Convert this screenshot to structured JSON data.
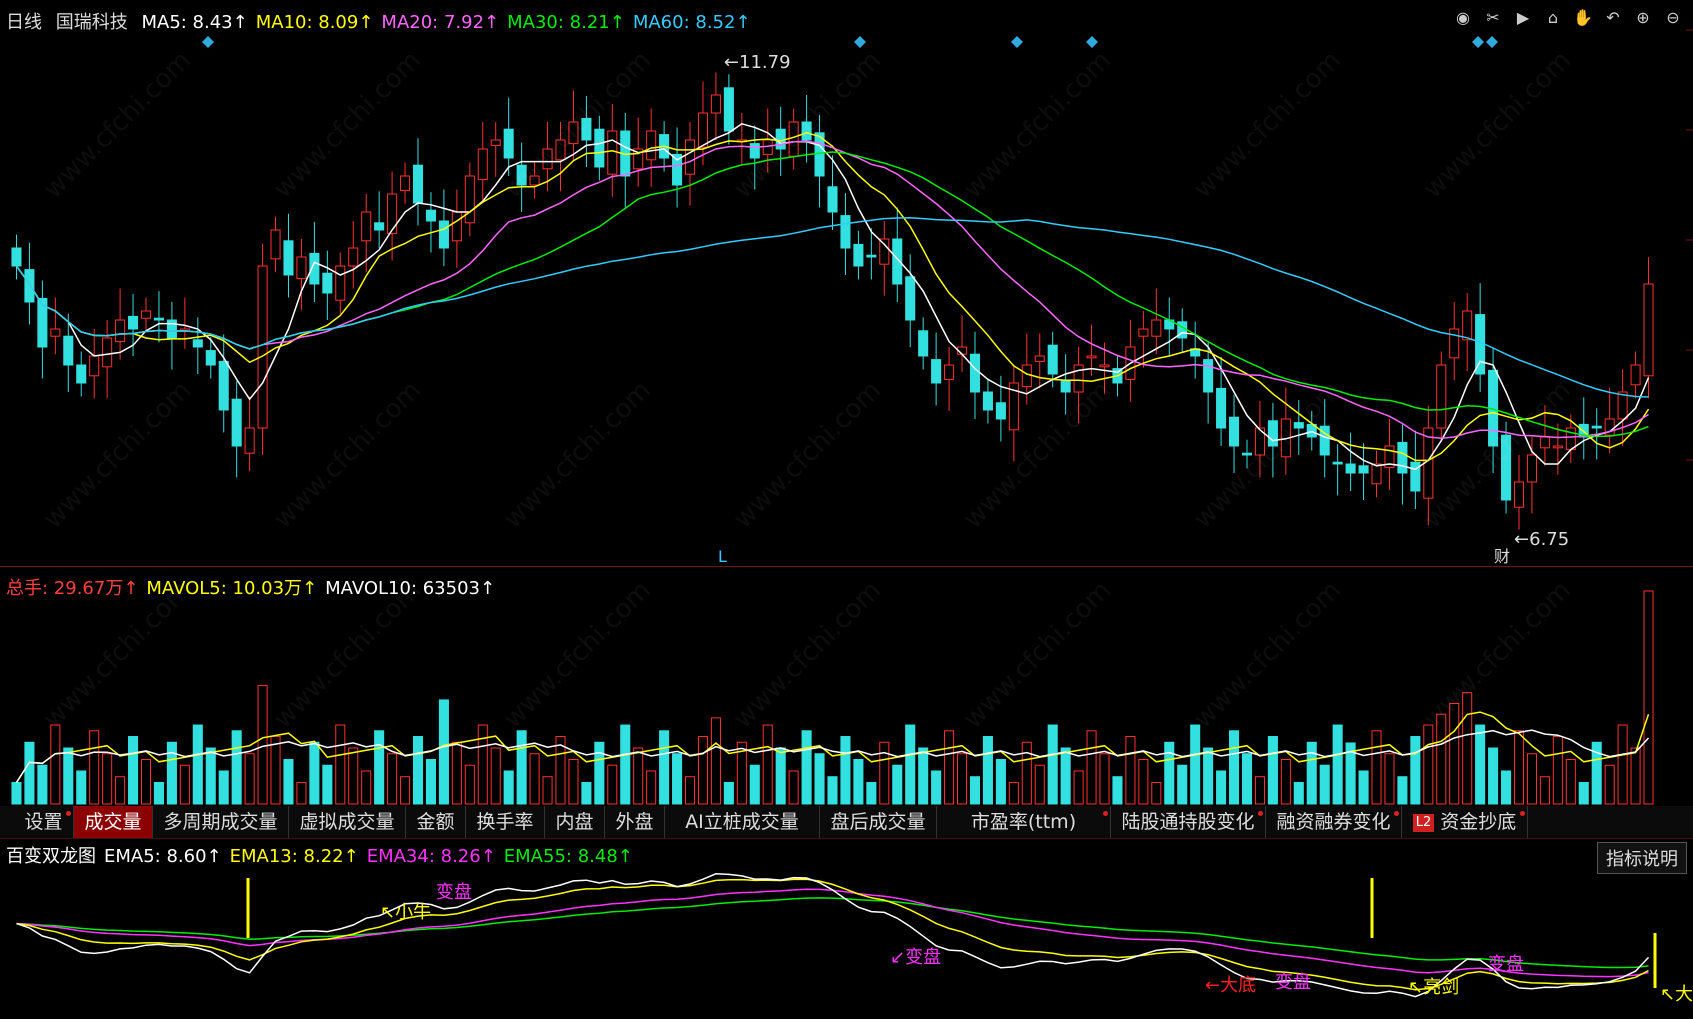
{
  "header": {
    "period": "日线",
    "stock_name": "国瑞科技",
    "ma_labels": [
      {
        "text": "MA5: 8.43↑",
        "color": "#ffffff"
      },
      {
        "text": "MA10: 8.09↑",
        "color": "#ffff00"
      },
      {
        "text": "MA20: 7.92↑",
        "color": "#ff66ff"
      },
      {
        "text": "MA30: 8.21↑",
        "color": "#00ee00"
      },
      {
        "text": "MA60: 8.52↑",
        "color": "#33ccff"
      }
    ]
  },
  "price_annotations": {
    "high": "11.79",
    "low": "6.75",
    "cai": "财",
    "l_marker": "L"
  },
  "toolbar_icons": [
    "eye-icon",
    "scissors-icon",
    "play-icon",
    "lock-icon",
    "hand-icon",
    "undo-icon",
    "zoom-in-icon",
    "zoom-out-icon"
  ],
  "volume_header": [
    {
      "text": "总手: 29.67万↑",
      "color": "#ff4040"
    },
    {
      "text": "MAVOL5: 10.03万↑",
      "color": "#ffff00"
    },
    {
      "text": "MAVOL10: 63503↑",
      "color": "#ffffff"
    }
  ],
  "tabs": [
    {
      "label": "设置",
      "dot": true
    },
    {
      "label": "成交量",
      "active": true
    },
    {
      "label": "多周期成交量"
    },
    {
      "label": "虚拟成交量"
    },
    {
      "label": "金额"
    },
    {
      "label": "换手率"
    },
    {
      "label": "内盘"
    },
    {
      "label": "外盘"
    },
    {
      "label": "AI立桩成交量"
    },
    {
      "label": "盘后成交量"
    },
    {
      "label": "市盈率(ttm)",
      "dot": true
    },
    {
      "label": "陆股通持股变化",
      "dot": true
    },
    {
      "label": "融资融券变化",
      "dot": true
    },
    {
      "label": "资金抄底",
      "badge": "L2",
      "dot": true
    }
  ],
  "dragon_header": [
    {
      "text": "百变双龙图",
      "color": "#ffffff"
    },
    {
      "text": "EMA5: 8.60↑",
      "color": "#ffffff"
    },
    {
      "text": "EMA13: 8.22↑",
      "color": "#ffff00"
    },
    {
      "text": "EMA34: 8.26↑",
      "color": "#ff33ff"
    },
    {
      "text": "EMA55: 8.48↑",
      "color": "#00ee00"
    }
  ],
  "explain_button": "指标说明",
  "dragon_annotations": [
    "↖小牛",
    "变盘",
    "↙变盘",
    "←大底",
    "变盘",
    "↖亮剑",
    "变盘",
    "↖大"
  ],
  "watermark": "www.cfchi.com",
  "chart_data": {
    "type": "candlestick",
    "price_range": [
      6.5,
      12.0
    ],
    "high": 11.79,
    "low": 6.75,
    "ma_last": {
      "MA5": 8.43,
      "MA10": 8.09,
      "MA20": 7.92,
      "MA30": 8.21,
      "MA60": 8.52
    },
    "close": [
      9.6,
      9.2,
      8.7,
      8.9,
      8.5,
      8.3,
      8.6,
      8.8,
      9.0,
      8.9,
      9.1,
      9.0,
      8.8,
      8.9,
      8.7,
      8.5,
      8.0,
      7.6,
      7.8,
      9.6,
      10.0,
      9.5,
      9.7,
      9.4,
      9.3,
      9.6,
      9.8,
      10.2,
      10.0,
      10.4,
      10.6,
      10.3,
      10.1,
      9.8,
      10.2,
      10.6,
      10.9,
      11.0,
      10.8,
      10.5,
      10.6,
      10.9,
      11.0,
      11.2,
      11.0,
      10.7,
      11.1,
      10.6,
      10.9,
      11.1,
      10.8,
      10.5,
      11.0,
      11.3,
      11.5,
      11.1,
      11.0,
      10.8,
      11.0,
      10.9,
      11.2,
      11.0,
      10.6,
      10.2,
      9.8,
      9.6,
      9.7,
      9.9,
      9.4,
      9.0,
      8.6,
      8.3,
      8.5,
      8.7,
      8.2,
      8.0,
      7.9,
      8.3,
      8.5,
      8.6,
      8.4,
      8.2,
      8.5,
      8.6,
      8.5,
      8.3,
      8.7,
      8.9,
      9.0,
      8.9,
      8.8,
      8.6,
      8.2,
      7.8,
      7.6,
      7.5,
      7.8,
      7.6,
      7.9,
      7.8,
      7.7,
      7.5,
      7.4,
      7.3,
      7.3,
      7.4,
      7.6,
      7.3,
      7.1,
      7.8,
      8.5,
      8.9,
      9.1,
      8.4,
      7.6,
      7.0,
      7.2,
      7.5,
      7.7,
      7.6,
      7.8,
      7.7,
      7.8,
      7.9,
      8.2,
      8.5,
      9.4
    ],
    "volume_max": 29.67,
    "volume_unit": "万"
  }
}
